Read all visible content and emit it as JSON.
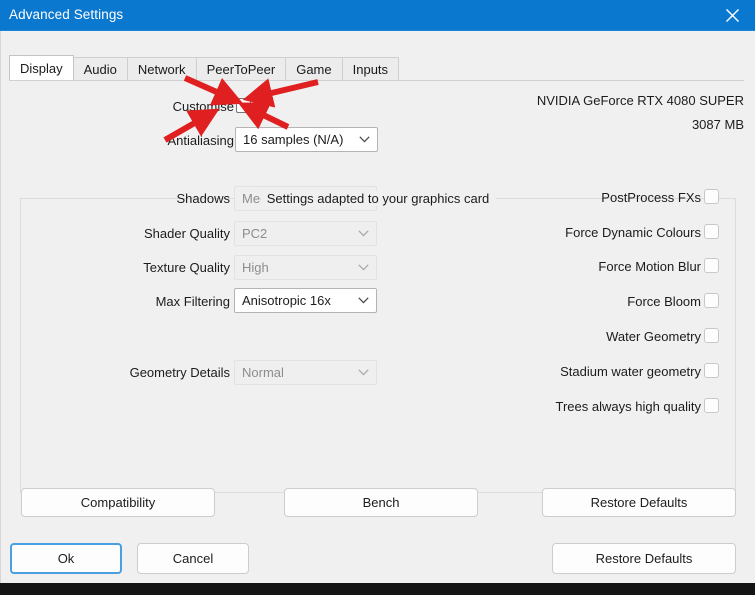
{
  "window": {
    "title": "Advanced Settings",
    "close_icon": "close-icon"
  },
  "tabs": [
    {
      "label": "Display",
      "active": true
    },
    {
      "label": "Audio",
      "active": false
    },
    {
      "label": "Network",
      "active": false
    },
    {
      "label": "PeerToPeer",
      "active": false
    },
    {
      "label": "Game",
      "active": false
    },
    {
      "label": "Inputs",
      "active": false
    }
  ],
  "top": {
    "customise_label": "Customise",
    "customise_checked": false,
    "antialiasing_label": "Antialiasing",
    "antialiasing_value": "16 samples (N/A)",
    "gpu_name": "NVIDIA GeForce RTX 4080 SUPER",
    "gpu_memory": "3087 MB"
  },
  "group": {
    "caption": "Settings adapted to your graphics card",
    "dropdowns": [
      {
        "label": "Shadows",
        "value": "Medium",
        "disabled": true
      },
      {
        "label": "Shader Quality",
        "value": "PC2",
        "disabled": true
      },
      {
        "label": "Texture Quality",
        "value": "High",
        "disabled": true
      },
      {
        "label": "Max Filtering",
        "value": "Anisotropic 16x",
        "disabled": false
      },
      {
        "label": "Geometry Details",
        "value": "Normal",
        "disabled": true
      }
    ],
    "checkboxes": [
      {
        "label": "PostProcess FXs",
        "checked": false
      },
      {
        "label": "Force Dynamic Colours",
        "checked": false
      },
      {
        "label": "Force Motion Blur",
        "checked": false
      },
      {
        "label": "Force Bloom",
        "checked": false
      },
      {
        "label": "Water Geometry",
        "checked": false
      },
      {
        "label": "Stadium water geometry",
        "checked": false
      },
      {
        "label": "Trees always high quality",
        "checked": false
      }
    ],
    "buttons": {
      "compatibility": "Compatibility",
      "bench": "Bench",
      "restore_defaults": "Restore Defaults"
    }
  },
  "footer": {
    "ok": "Ok",
    "cancel": "Cancel",
    "restore_defaults": "Restore Defaults"
  },
  "colors": {
    "titlebar": "#0b78d0",
    "annotation_arrow": "#e02020",
    "focus_border": "#4a9fe0"
  }
}
